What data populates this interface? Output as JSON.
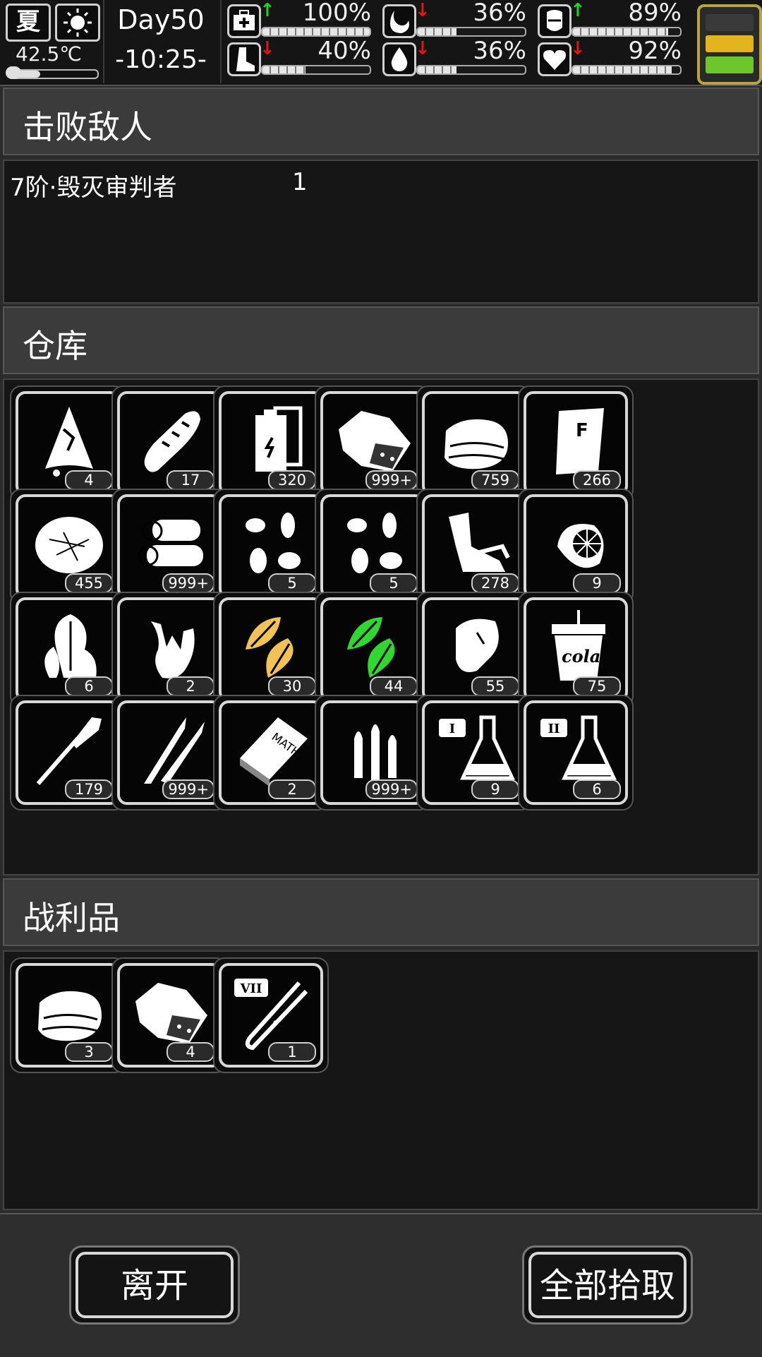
{
  "status": {
    "season": "夏",
    "weather_icon": "sun-icon",
    "temperature": "42.5℃",
    "temperature_level": 0.35,
    "day": "Day50",
    "time": "-10:25-",
    "stats": [
      {
        "id": "health",
        "icon": "medkit-icon",
        "trend": "up",
        "value": "100%",
        "level": 1.0
      },
      {
        "id": "hunger",
        "icon": "stomach-icon",
        "trend": "down",
        "value": "36%",
        "level": 0.36
      },
      {
        "id": "armor",
        "icon": "armor-icon",
        "trend": "up",
        "value": "89%",
        "level": 0.89
      },
      {
        "id": "stamina",
        "icon": "foot-icon",
        "trend": "down",
        "value": "40%",
        "level": 0.4
      },
      {
        "id": "thirst",
        "icon": "water-drop-icon",
        "trend": "down",
        "value": "36%",
        "level": 0.36
      },
      {
        "id": "mood",
        "icon": "heart-icon",
        "trend": "down",
        "value": "92%",
        "level": 0.92
      }
    ],
    "energy": {
      "segments": [
        "#3a3a3a",
        "#e3b41e",
        "#6cc62c"
      ]
    }
  },
  "defeated": {
    "title": "击败敌人",
    "enemies": [
      {
        "name": "7阶·毁灭审判者",
        "count": "1"
      }
    ]
  },
  "warehouse": {
    "title": "仓库",
    "items": [
      {
        "icon": "raw-meat-icon",
        "count": "4"
      },
      {
        "icon": "bread-icon",
        "count": "17"
      },
      {
        "icon": "battery-icon",
        "count": "320"
      },
      {
        "icon": "meat-chunk-icon",
        "count": "999+"
      },
      {
        "icon": "cloth-icon",
        "count": "759"
      },
      {
        "icon": "fertilizer-bag-icon",
        "count": "266"
      },
      {
        "icon": "fiber-icon",
        "count": "455"
      },
      {
        "icon": "wood-logs-icon",
        "count": "999+"
      },
      {
        "icon": "seeds-icon",
        "count": "5"
      },
      {
        "icon": "seeds-icon",
        "count": "5"
      },
      {
        "icon": "scrap-metal-icon",
        "count": "278"
      },
      {
        "icon": "fruit-icon",
        "count": "9"
      },
      {
        "icon": "plant-icon",
        "count": "6"
      },
      {
        "icon": "ginger-icon",
        "count": "2"
      },
      {
        "icon": "tobacco-leaf-icon",
        "count": "30",
        "color": "#f2c255"
      },
      {
        "icon": "mint-leaf-icon",
        "count": "44",
        "color": "#2fd82f"
      },
      {
        "icon": "steak-icon",
        "count": "55"
      },
      {
        "icon": "cola-icon",
        "count": "75",
        "label": "cola"
      },
      {
        "icon": "rocket-icon",
        "count": "179"
      },
      {
        "icon": "rifle-bullet-icon",
        "count": "999+"
      },
      {
        "icon": "math-book-icon",
        "count": "2",
        "label": "MATH"
      },
      {
        "icon": "bullets-icon",
        "count": "999+"
      },
      {
        "icon": "flask-icon",
        "count": "9",
        "label": "I"
      },
      {
        "icon": "flask-icon",
        "count": "6",
        "label": "II"
      }
    ]
  },
  "loot": {
    "title": "战利品",
    "items": [
      {
        "icon": "cloth-icon",
        "count": "3"
      },
      {
        "icon": "meat-chunk-icon",
        "count": "4"
      },
      {
        "icon": "test-tube-icon",
        "count": "1",
        "label": "VII"
      }
    ]
  },
  "actions": {
    "leave_label": "离开",
    "take_all_label": "全部拾取"
  }
}
